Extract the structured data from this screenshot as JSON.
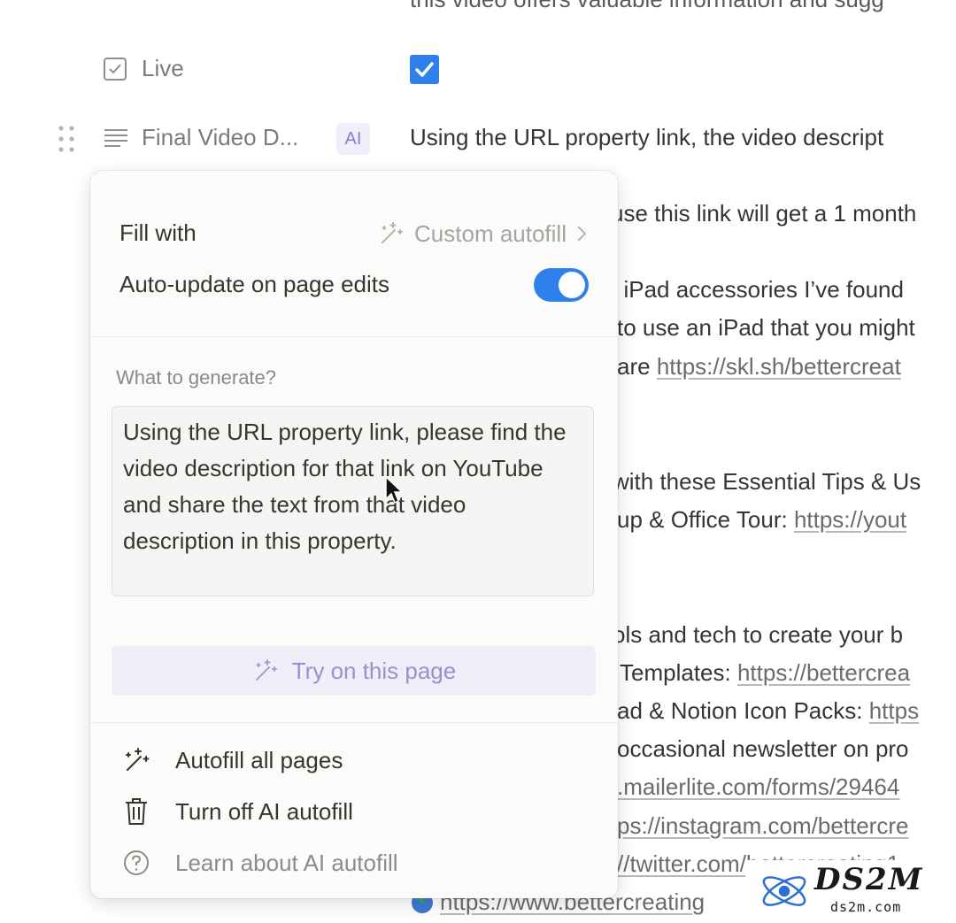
{
  "top_clipped_text": "this video offers valuable information and sugg",
  "properties": {
    "live": {
      "label": "Live",
      "checked": true
    },
    "final_video": {
      "label": "Final Video D...",
      "badge": "AI",
      "value_preview": "Using the URL property link, the video descript"
    }
  },
  "background_lines": [
    {
      "text": "use this link will get a 1 month",
      "link": ""
    },
    {
      "text": "t iPad accessories I’ve found",
      "link": ""
    },
    {
      "text": "to use an iPad that you might",
      "link": ""
    },
    {
      "text": "are ",
      "link": "https://skl.sh/bettercreat"
    },
    {
      "text": "with these Essential Tips & Us",
      "link": ""
    },
    {
      "text": "up & Office Tour: ",
      "link": "https://yout"
    },
    {
      "text": "ols and tech to create your b",
      "link": ""
    },
    {
      "text": "Templates: ",
      "link": "https://bettercrea"
    },
    {
      "text": "ad & Notion Icon Packs: ",
      "link": "https"
    },
    {
      "text": "occasional newsletter on pro",
      "link": ""
    },
    {
      "text": "",
      "link": ".mailerlite.com/forms/29464"
    },
    {
      "text": "",
      "link": "ps://instagram.com/bettercre"
    },
    {
      "text": "",
      "link": "//twitter.com/bettercreating1"
    },
    {
      "text": "",
      "link": "https://www.bettercreating"
    }
  ],
  "popup": {
    "fill_with_label": "Fill with",
    "fill_with_value": "Custom autofill",
    "auto_update_label": "Auto-update on page edits",
    "auto_update_on": true,
    "what_to_generate_label": "What to generate?",
    "prompt_text": "Using the URL property link, please find the video description for that link on YouTube and share the text from that video description in this property.",
    "try_button": "Try on this page",
    "menu": [
      {
        "label": "Autofill all pages",
        "icon": "sparkle-icon"
      },
      {
        "label": "Turn off AI autofill",
        "icon": "trash-icon"
      },
      {
        "label": "Learn about AI autofill",
        "icon": "help-circle-icon"
      }
    ]
  },
  "watermark": {
    "title": "DS2M",
    "subtitle": "ds2m.com"
  },
  "colors": {
    "accent": "#2f80ed",
    "ai_purple": "#9b8fd0"
  }
}
